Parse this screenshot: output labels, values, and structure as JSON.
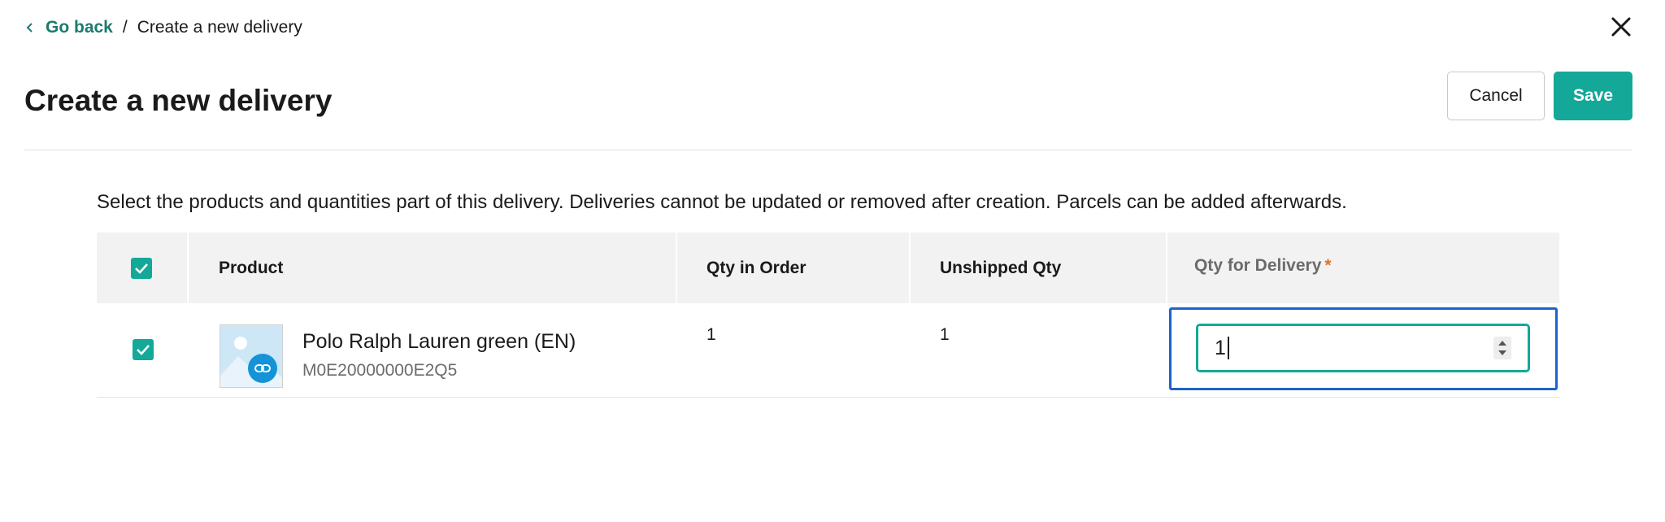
{
  "breadcrumb": {
    "back_label": "Go back",
    "separator": "/",
    "current": "Create a new delivery"
  },
  "page": {
    "title": "Create a new delivery"
  },
  "actions": {
    "cancel_label": "Cancel",
    "save_label": "Save"
  },
  "intro_text": "Select the products and quantities part of this delivery. Deliveries cannot be updated or removed after creation. Parcels can be added afterwards.",
  "table": {
    "columns": {
      "product": "Product",
      "qty_in_order": "Qty in Order",
      "unshipped_qty": "Unshipped Qty",
      "qty_for_delivery": "Qty for Delivery",
      "required_marker": "*"
    },
    "select_all_checked": true,
    "rows": [
      {
        "checked": true,
        "product_name": "Polo Ralph Lauren green (EN)",
        "sku": "M0E20000000E2Q5",
        "qty_in_order": "1",
        "unshipped_qty": "1",
        "qty_for_delivery": "1"
      }
    ]
  },
  "icons": {
    "back": "chevron-left-icon",
    "close": "close-icon",
    "checkbox": "checkmark-icon",
    "thumbnail": "image-placeholder-icon",
    "thumbnail_badge": "link-icon",
    "spinner": "stepper-arrows-icon"
  },
  "colors": {
    "accent": "#14a898",
    "link": "#1b7b6f",
    "focus": "#1e63c9",
    "required": "#e5702a",
    "header_bg": "#f2f2f2"
  }
}
